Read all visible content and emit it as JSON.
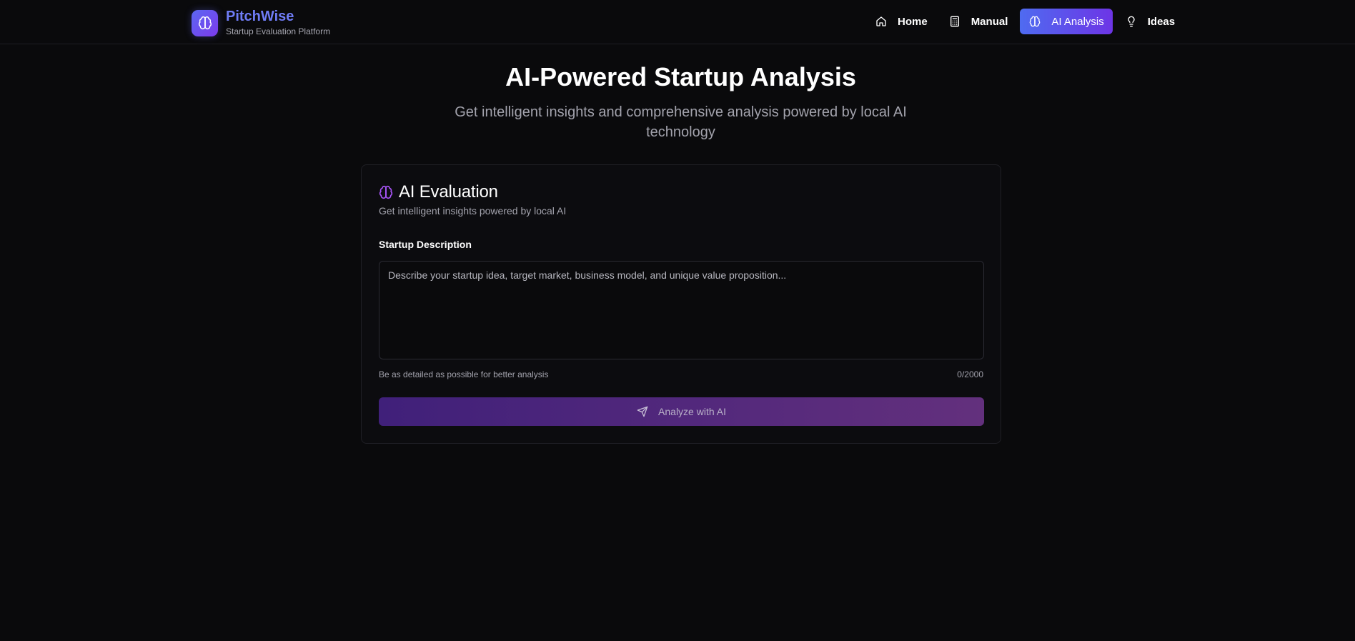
{
  "brand": {
    "name": "PitchWise",
    "tagline": "Startup Evaluation Platform"
  },
  "nav": {
    "items": [
      {
        "label": "Home",
        "icon": "home-icon",
        "active": false
      },
      {
        "label": "Manual",
        "icon": "calculator-icon",
        "active": false
      },
      {
        "label": "AI Analysis",
        "icon": "brain-icon",
        "active": true
      },
      {
        "label": "Ideas",
        "icon": "lightbulb-icon",
        "active": false
      }
    ]
  },
  "hero": {
    "title": "AI-Powered Startup Analysis",
    "subtitle": "Get intelligent insights and comprehensive analysis powered by local AI technology"
  },
  "card": {
    "title": "AI Evaluation",
    "description": "Get intelligent insights powered by local AI",
    "field_label": "Startup Description",
    "textarea": {
      "placeholder": "Describe your startup idea, target market, business model, and unique value proposition...",
      "value": ""
    },
    "hint": "Be as detailed as possible for better analysis",
    "counter": "0/2000",
    "analyze_label": "Analyze with AI"
  },
  "colors": {
    "background": "#0a0a0c",
    "brand_accent": "#6f7cf6",
    "nav_active_start": "#4f6bf0",
    "nav_active_end": "#6d35e6",
    "brain_icon": "#a855f7",
    "button_start": "#40207a",
    "button_end": "#63307d"
  }
}
